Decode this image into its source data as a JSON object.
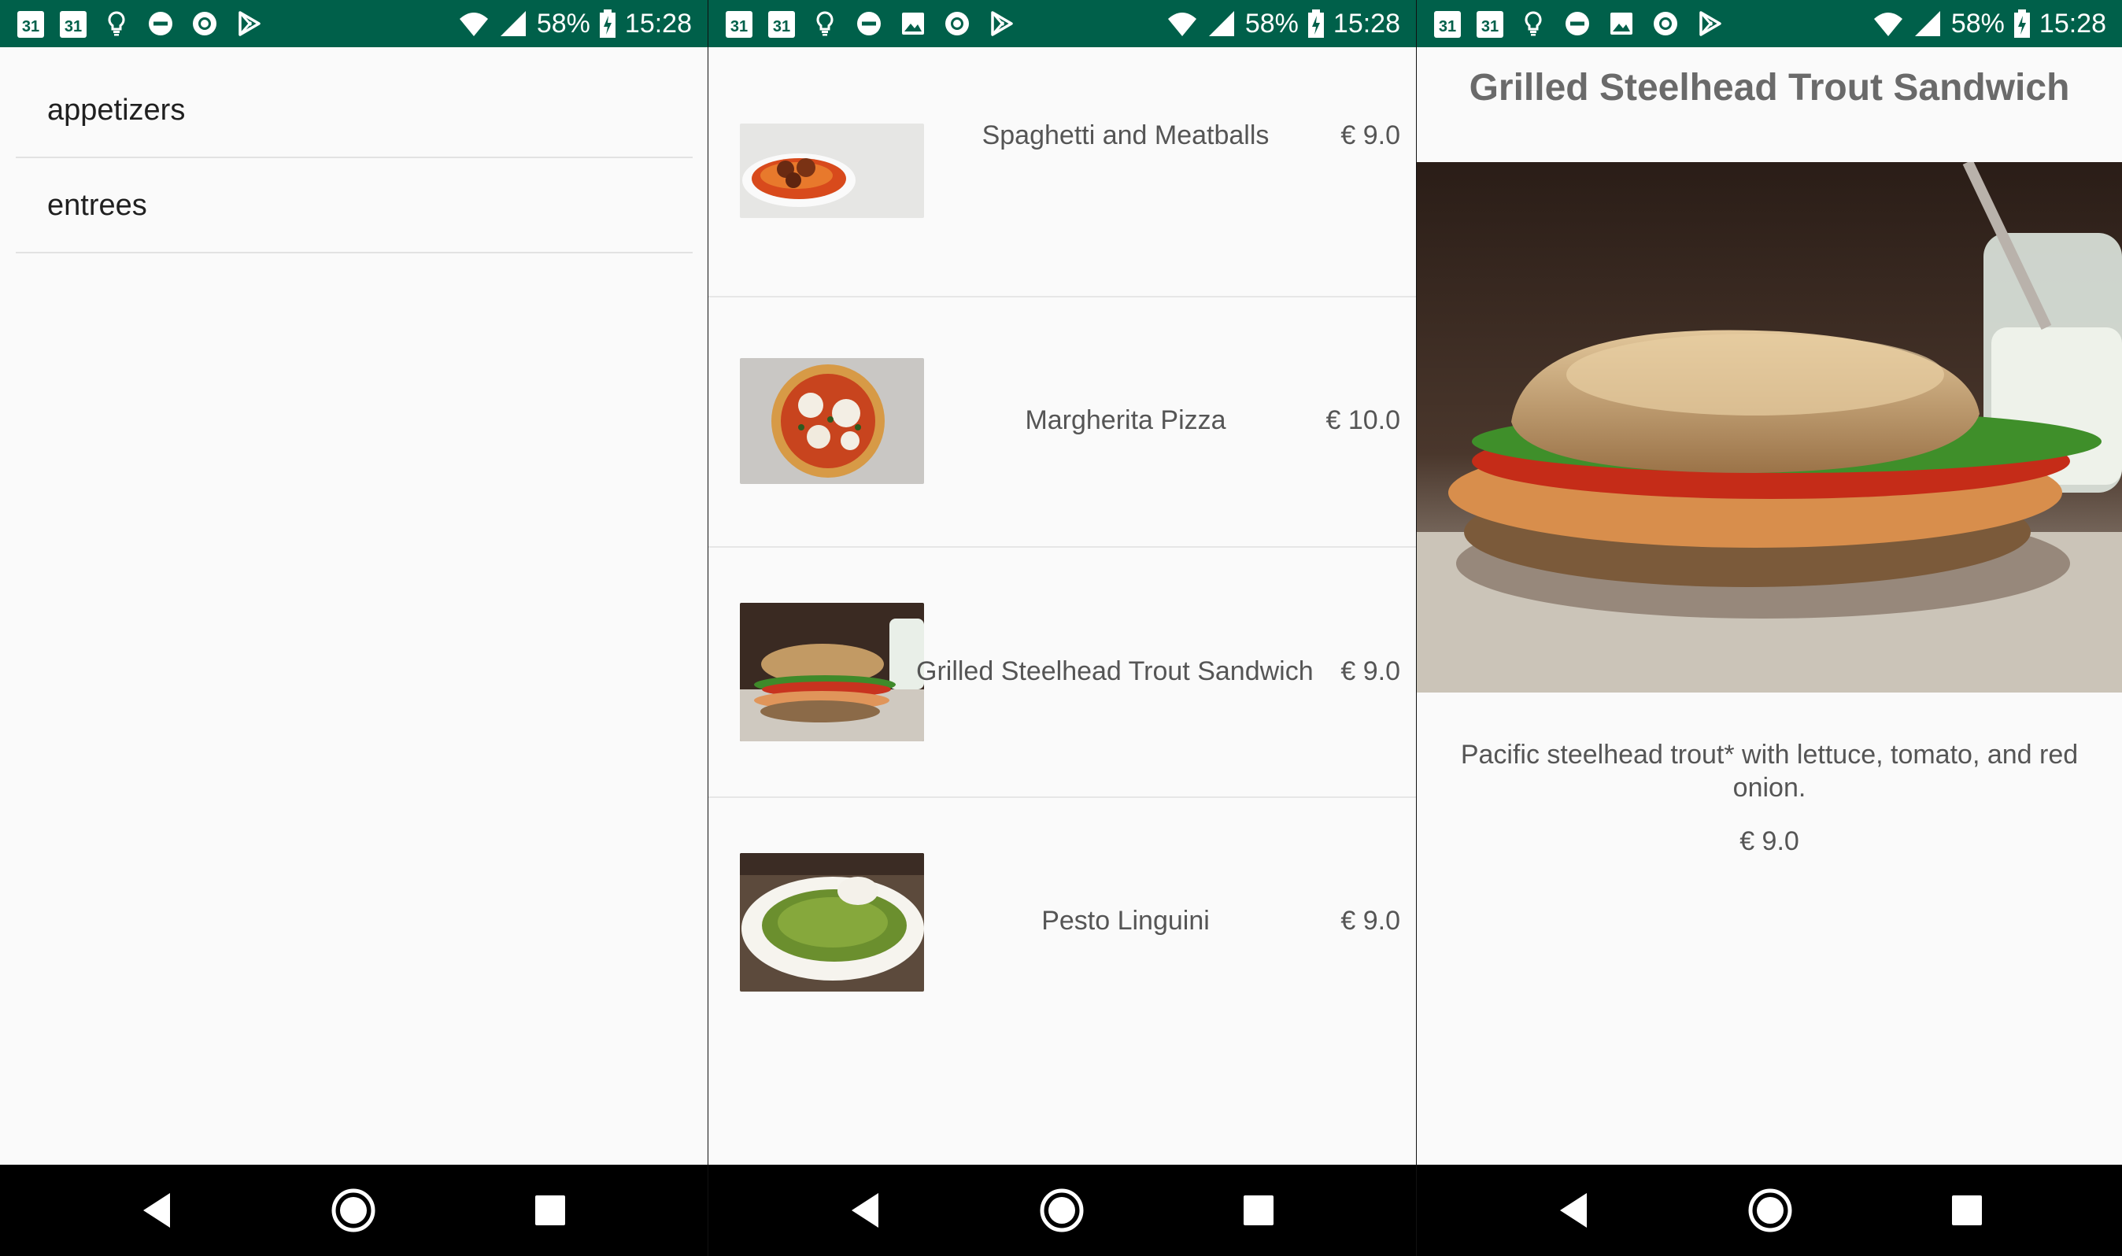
{
  "status_bar": {
    "calendar_day_1": "31",
    "calendar_day_2": "31",
    "battery": "58%",
    "time": "15:28",
    "icons_left_panel1": [
      "calendar-icon",
      "calendar-icon",
      "lightbulb-icon",
      "do-not-disturb-icon",
      "circle-icon",
      "play-store-icon"
    ],
    "icons_left_panels2_3": [
      "calendar-icon",
      "calendar-icon",
      "lightbulb-icon",
      "do-not-disturb-icon",
      "image-icon",
      "circle-icon",
      "play-store-icon"
    ],
    "icons_right": [
      "wifi-icon",
      "signal-icon",
      "battery-charging-icon"
    ]
  },
  "categories": {
    "items": [
      {
        "label": "appetizers"
      },
      {
        "label": "entrees"
      }
    ]
  },
  "menu": {
    "items": [
      {
        "name": "Spaghetti and Meatballs",
        "price": "€ 9.0",
        "image": "spaghetti-meatballs-photo"
      },
      {
        "name": "Margherita Pizza",
        "price": "€ 10.0",
        "image": "margherita-pizza-photo"
      },
      {
        "name": "Grilled Steelhead Trout Sandwich",
        "price": "€ 9.0",
        "image": "trout-sandwich-photo"
      },
      {
        "name": "Pesto Linguini",
        "price": "€ 9.0",
        "image": "pesto-linguini-photo"
      }
    ]
  },
  "detail": {
    "title": "Grilled Steelhead Trout Sandwich",
    "description": "Pacific steelhead trout* with lettuce, tomato, and red onion.",
    "price": "€ 9.0",
    "image": "trout-sandwich-photo"
  },
  "nav_bar": {
    "buttons": [
      "back-icon",
      "home-icon",
      "recents-icon"
    ]
  },
  "colors": {
    "status_bar_bg": "#00604a",
    "page_bg": "#fafafa",
    "nav_bar_bg": "#000000",
    "divider": "#e2e2e2",
    "text": "#555555"
  }
}
